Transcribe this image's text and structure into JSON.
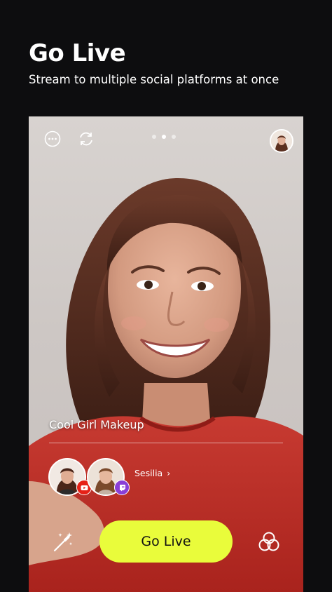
{
  "header": {
    "title": "Go Live",
    "subtitle": "Stream to multiple social platforms at once"
  },
  "preview": {
    "top_bar": {
      "more_icon": "more-icon",
      "switch_camera_icon": "switch-camera-icon",
      "page_indicator": {
        "count": 3,
        "active": 2
      }
    },
    "stream_title": "Cool Girl Makeup",
    "accounts": [
      {
        "platform": "YouTube",
        "badge_color": "#e62117",
        "badge_icon": "youtube-icon"
      },
      {
        "platform": "Twitch",
        "badge_color": "#8a3ed6",
        "badge_icon": "twitch-icon"
      }
    ],
    "account_name": "Sesilia",
    "account_chevron": "›",
    "go_live_label": "Go Live",
    "beauty_icon": "magic-wand-icon",
    "filter_icon": "filters-icon"
  },
  "colors": {
    "background": "#0d0d0f",
    "accent": "#e9fc3b",
    "sweater": "#c0302a"
  }
}
